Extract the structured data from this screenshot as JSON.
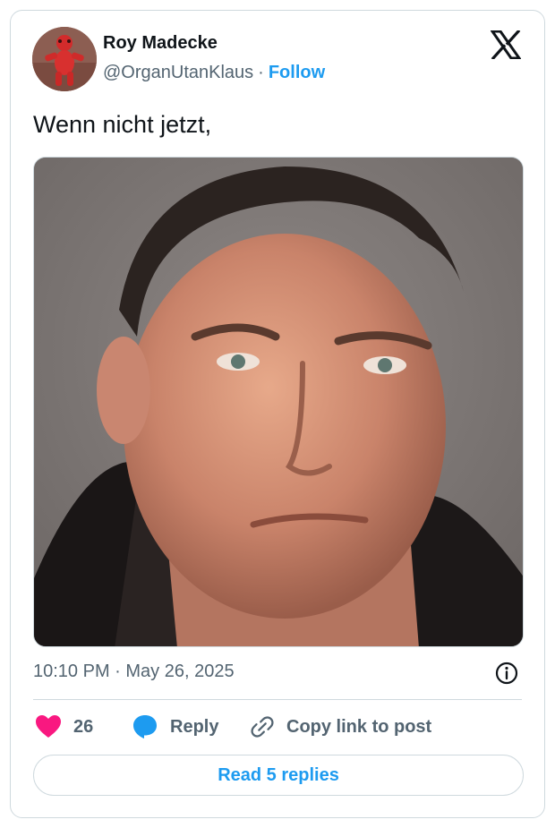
{
  "author": {
    "name": "Roy Madecke",
    "handle": "@OrganUtanKlaus",
    "separator": "·",
    "follow_label": "Follow",
    "avatar_icon": "red-plush-toy-avatar"
  },
  "brand": {
    "logo_icon": "x-logo-icon"
  },
  "tweet": {
    "text": "Wenn nicht jetzt,",
    "media_description_icon": "photo-portrait",
    "timestamp": "10:10 PM · May 26, 2025"
  },
  "actions": {
    "like_count": "26",
    "reply_label": "Reply",
    "copy_link_label": "Copy link to post",
    "read_replies_label": "Read 5 replies"
  },
  "colors": {
    "accent": "#1d9bf0",
    "like": "#f91880",
    "text_primary": "#0f1419",
    "text_secondary": "#536471",
    "border": "#cfd9de"
  }
}
